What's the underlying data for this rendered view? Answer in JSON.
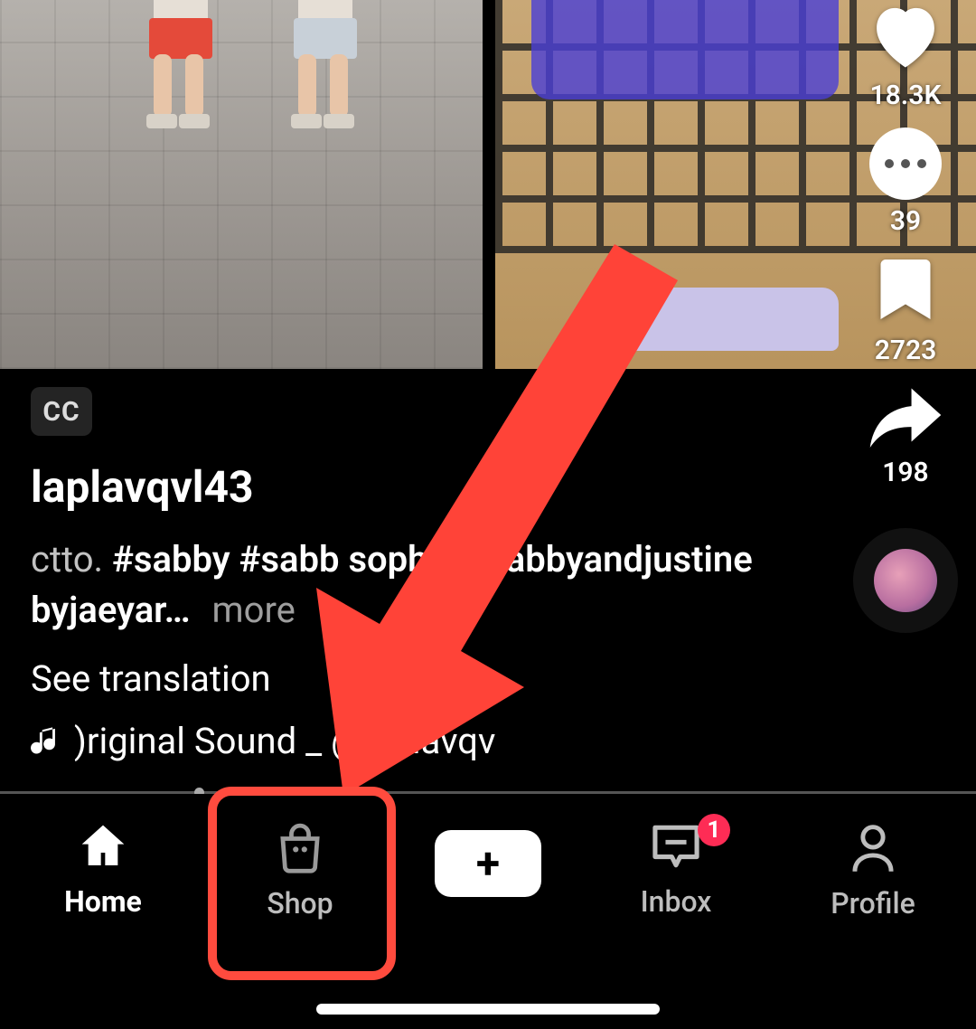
{
  "rail": {
    "likes": "18.3K",
    "comments": "39",
    "bookmarks": "2723",
    "shares": "198"
  },
  "cc_label": "CC",
  "caption": {
    "username": "laplavqvl43",
    "ctto": "ctto.",
    "hashtags": "#sabby #sabb       sophia #sabbyandjustine         byjaeyar…",
    "more": "more",
    "see_translation": "See translation",
    "sound": ")riginal Sound _ @laplavqv"
  },
  "nav": {
    "home": "Home",
    "shop": "Shop",
    "inbox": "Inbox",
    "profile": "Profile",
    "inbox_badge": "1"
  }
}
